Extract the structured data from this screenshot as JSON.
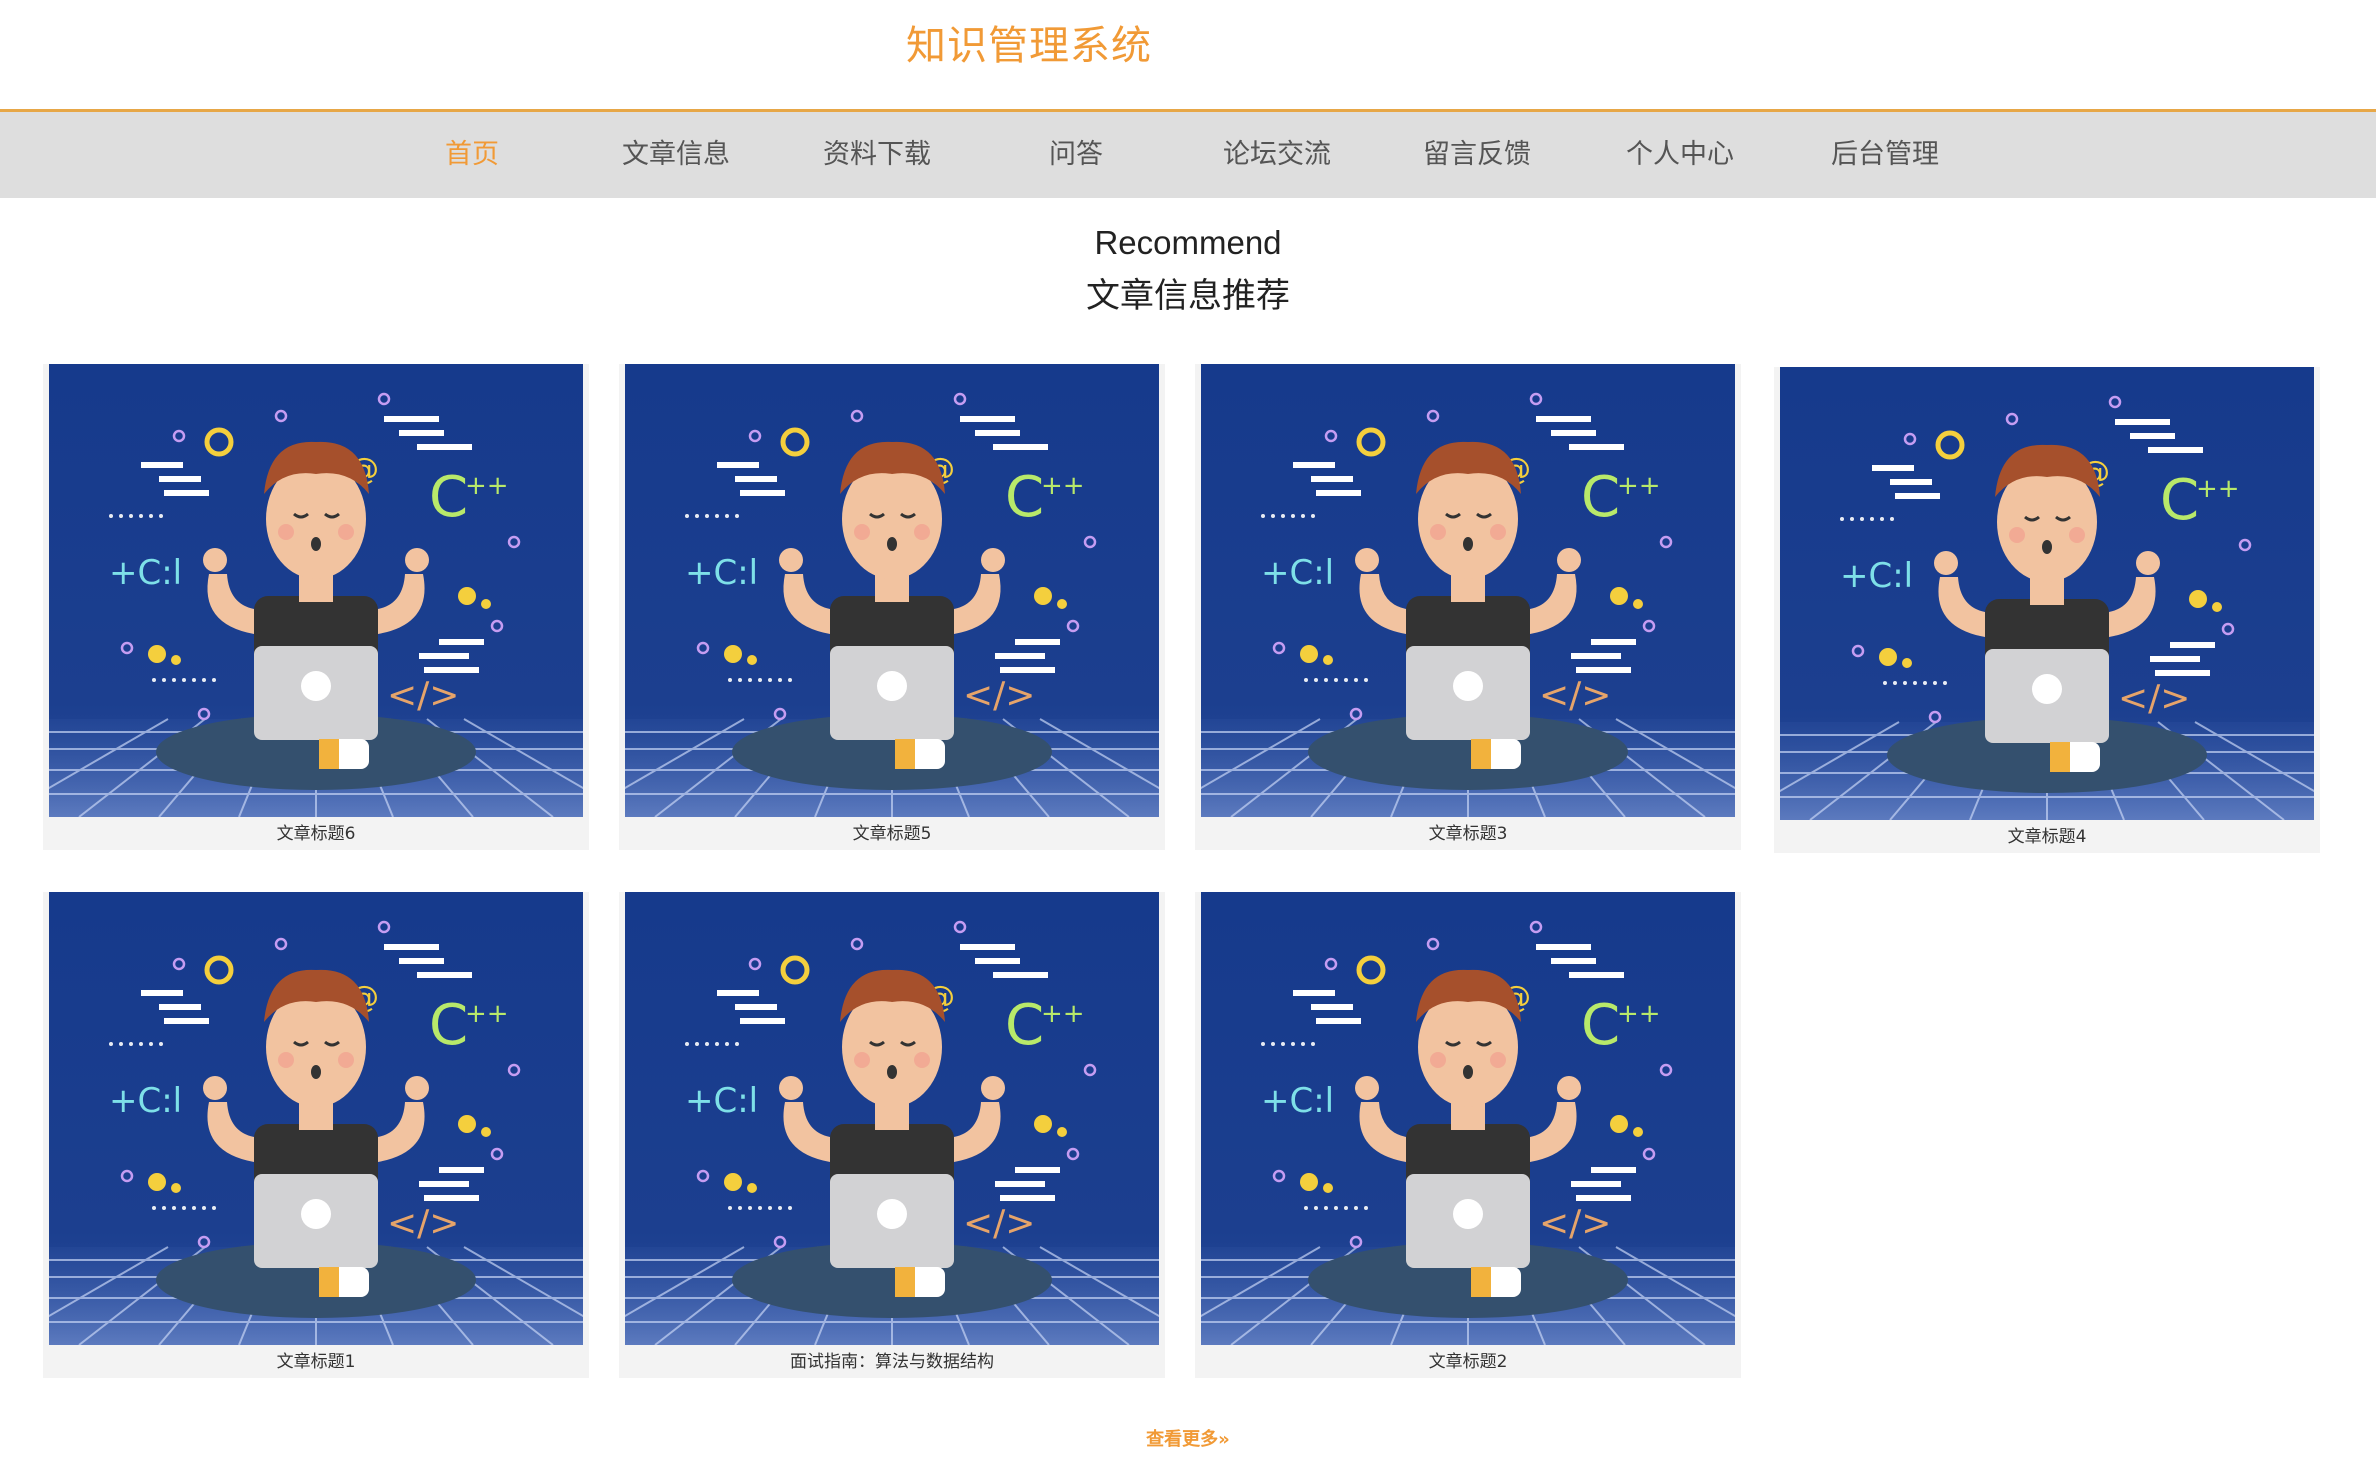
{
  "header": {
    "title": "知识管理系统"
  },
  "nav": {
    "items": [
      {
        "label": "首页",
        "active": true
      },
      {
        "label": "文章信息"
      },
      {
        "label": "资料下载"
      },
      {
        "label": "问答"
      },
      {
        "label": "论坛交流"
      },
      {
        "label": "留言反馈"
      },
      {
        "label": "个人中心"
      },
      {
        "label": "后台管理"
      }
    ]
  },
  "recommend": {
    "title_en": "Recommend",
    "title_cn": "文章信息推荐",
    "cards": [
      {
        "caption": "文章标题6"
      },
      {
        "caption": "文章标题5"
      },
      {
        "caption": "文章标题3"
      },
      {
        "caption": "文章标题4"
      },
      {
        "caption": "文章标题1"
      },
      {
        "caption": "面试指南：算法与数据结构"
      },
      {
        "caption": "文章标题2"
      }
    ],
    "more_label": "查看更多»"
  },
  "colors": {
    "accent": "#f19a36",
    "nav_bg": "#dedede",
    "nav_border": "#e7a747",
    "card_bg": "#1b3a8e"
  },
  "icons": {
    "card_image": "meditating-coder-illustration"
  }
}
